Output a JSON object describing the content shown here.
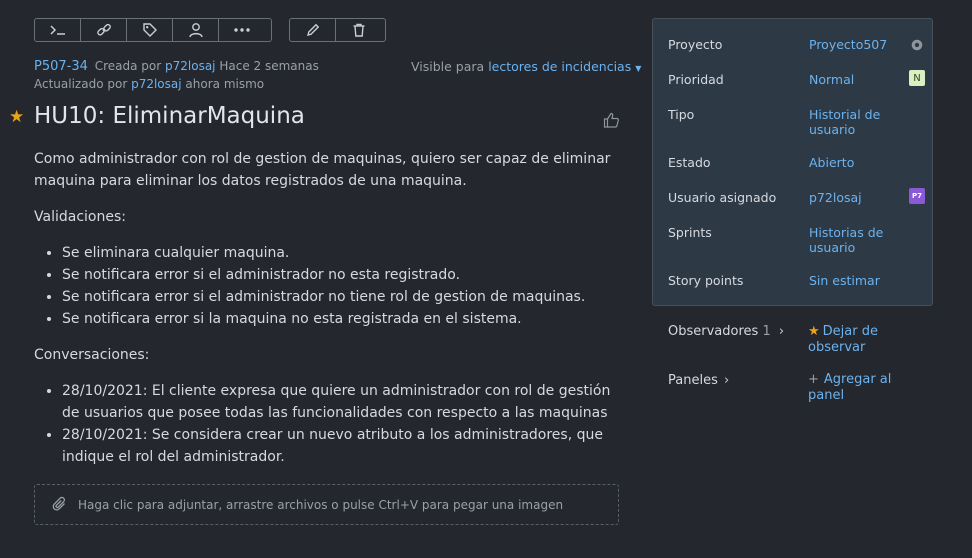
{
  "toolbar": {
    "left_icons": [
      "terminal-icon",
      "link-icon",
      "tag-icon",
      "user-icon",
      "more-icon"
    ],
    "right_icons": [
      "pencil-icon",
      "trash-icon"
    ]
  },
  "issue": {
    "id": "P507-34",
    "created_prefix": "Creada por",
    "creator": "p72losaj",
    "created_when": "Hace 2 semanas",
    "updated_prefix": "Actualizado por",
    "updater": "p72losaj",
    "updated_when": "ahora mismo",
    "visible_prefix": "Visible para",
    "visible_link": "lectores de incidencias",
    "title": "HU10: EliminarMaquina"
  },
  "description": {
    "intro": "Como administrador con rol de gestion de maquinas, quiero ser capaz de eliminar maquina para eliminar los datos registrados de una maquina.",
    "validations_heading": "Validaciones:",
    "validations": [
      "Se eliminara cualquier maquina.",
      "Se notificara error si el administrador no esta registrado.",
      "Se notificara error si el administrador no tiene rol de gestion de maquinas.",
      "Se notificara error si la maquina no esta registrada en el sistema."
    ],
    "conversations_heading": "Conversaciones:",
    "conversations": [
      "28/10/2021: El cliente expresa que quiere un administrador con rol de gestión de usuarios que posee todas las funcionalidades con respecto a las maquinas",
      "28/10/2021: Se considera crear un nuevo atributo a los administradores, que indique el rol del administrador."
    ]
  },
  "attach_text": "Haga clic para adjuntar, arrastre archivos o pulse Ctrl+V para pegar una imagen",
  "props": {
    "proyecto_label": "Proyecto",
    "proyecto_value": "Proyecto507",
    "prioridad_label": "Prioridad",
    "prioridad_value": "Normal",
    "prioridad_badge": "N",
    "tipo_label": "Tipo",
    "tipo_value": "Historial de usuario",
    "estado_label": "Estado",
    "estado_value": "Abierto",
    "asignado_label": "Usuario asignado",
    "asignado_value": "p72losaj",
    "asignado_avatar": "P7",
    "sprints_label": "Sprints",
    "sprints_value": "Historias de usuario",
    "points_label": "Story points",
    "points_value": "Sin estimar"
  },
  "side": {
    "watchers_label": "Observadores",
    "watchers_count": "1",
    "unwatch_label": "Dejar de observar",
    "boards_label": "Paneles",
    "add_board_label": "Agregar al panel"
  },
  "colors": {
    "accent": "#6cb2ee",
    "star": "#e8a317",
    "background": "#24272d",
    "panel": "#2d3a46"
  }
}
